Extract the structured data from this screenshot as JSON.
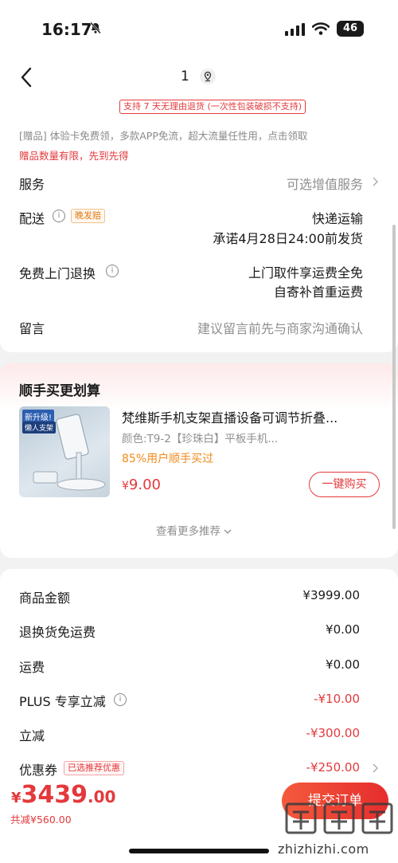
{
  "status_bar": {
    "time": "16:17",
    "battery": "46"
  },
  "nav": {
    "title_number": "1"
  },
  "notice": {
    "return_policy": "支持 7 天无理由退货 (一次性包装破损不支持)",
    "gift_line": "[赠品] 体验卡免费领，多款APP免流，超大流量任性用，点击领取",
    "gift_limit": "赠品数量有限，先到先得"
  },
  "service_rows": {
    "service": {
      "label": "服务",
      "value": "可选增值服务"
    },
    "delivery": {
      "label": "配送",
      "tag": "晚发赔",
      "value_line1": "快递运输",
      "value_line2": "承诺4月28日24:00前发货"
    },
    "free_return": {
      "label": "免费上门退换",
      "value_line1": "上门取件享运费全免",
      "value_line2": "自寄补首重运费"
    },
    "message": {
      "label": "留言",
      "placeholder": "建议留言前先与商家沟通确认"
    }
  },
  "recommend": {
    "section_title": "顺手买更划算",
    "product": {
      "title": "梵维斯手机支架直播设备可调节折叠...",
      "spec": "颜色:T9-2【珍珠白】平板手机...",
      "rate": "85%用户顺手买过",
      "currency": "¥",
      "price": "9.00",
      "buy_label": "一键购买",
      "image_text_1": "新升级!",
      "image_text_2": "懒人支架"
    },
    "more_label": "查看更多推荐"
  },
  "summary": {
    "rows": [
      {
        "label": "商品金额",
        "value": "¥3999.00"
      },
      {
        "label": "退换货免运费",
        "value": "¥0.00"
      },
      {
        "label": "运费",
        "value": "¥0.00"
      },
      {
        "label": "PLUS 专享立减",
        "value": "-¥10.00"
      },
      {
        "label": "立减",
        "value": "-¥300.00"
      },
      {
        "label": "优惠券",
        "tag": "已选推荐优惠",
        "value": "-¥250.00"
      }
    ]
  },
  "bottom_bar": {
    "currency": "¥",
    "total_int": "3439",
    "total_dec": ".00",
    "saved": "共减¥560.00",
    "submit_label": "提交订单"
  },
  "watermark": {
    "text": "zhizhizhi.com"
  },
  "colors": {
    "accent_red": "#e4393c",
    "orange": "#f08a1c"
  }
}
